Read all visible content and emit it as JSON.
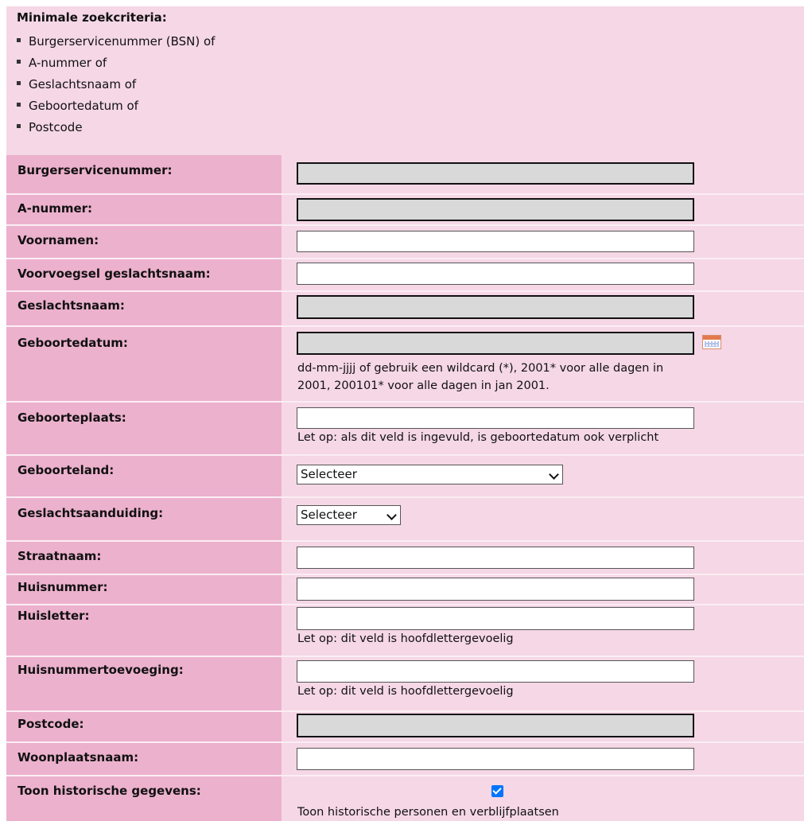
{
  "criteria": {
    "title": "Minimale zoekcriteria:",
    "items": [
      "Burgerservicenummer (BSN) of",
      "A-nummer of",
      "Geslachtsnaam of",
      "Geboortedatum of",
      "Postcode"
    ]
  },
  "fields": {
    "bsn": {
      "label": "Burgerservicenummer:",
      "value": ""
    },
    "anummer": {
      "label": "A-nummer:",
      "value": ""
    },
    "voornamen": {
      "label": "Voornamen:",
      "value": ""
    },
    "voorvoegsel": {
      "label": "Voorvoegsel geslachtsnaam:",
      "value": ""
    },
    "geslachtsnaam": {
      "label": "Geslachtsnaam:",
      "value": ""
    },
    "geboortedatum": {
      "label": "Geboortedatum:",
      "value": "",
      "hint_line1": "dd-mm-jjjj of gebruik een wildcard (*), 2001* voor alle dagen in",
      "hint_line2": "2001, 200101* voor alle dagen in jan 2001."
    },
    "geboorteplaats": {
      "label": "Geboorteplaats:",
      "value": "",
      "hint": "Let op: als dit veld is ingevuld, is geboortedatum ook verplicht"
    },
    "geboorteland": {
      "label": "Geboorteland:",
      "selected": "Selecteer"
    },
    "geslachtsaanduiding": {
      "label": "Geslachtsaanduiding:",
      "selected": "Selecteer"
    },
    "straatnaam": {
      "label": "Straatnaam:",
      "value": ""
    },
    "huisnummer": {
      "label": "Huisnummer:",
      "value": ""
    },
    "huisletter": {
      "label": "Huisletter:",
      "value": "",
      "hint": "Let op: dit veld is hoofdlettergevoelig"
    },
    "huisnummertoevoeging": {
      "label": "Huisnummertoevoeging:",
      "value": "",
      "hint": "Let op: dit veld is hoofdlettergevoelig"
    },
    "postcode": {
      "label": "Postcode:",
      "value": ""
    },
    "woonplaatsnaam": {
      "label": "Woonplaatsnaam:",
      "value": ""
    },
    "historisch": {
      "label": "Toon historische gegevens:",
      "checked": true,
      "hint": "Toon historische personen en verblijfplaatsen"
    }
  },
  "colors": {
    "label_bg": "#ecb1cd",
    "value_bg": "#f5d7e5",
    "checkbox": "#0075ff"
  }
}
